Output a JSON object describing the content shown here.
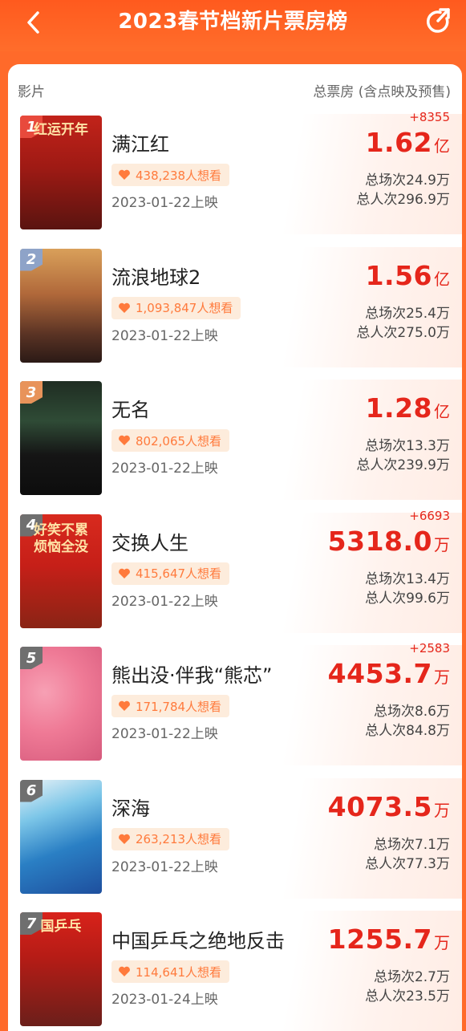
{
  "header": {
    "title": "2023春节档新片票房榜",
    "back_icon": "chevron-left-icon",
    "share_icon": "share-refresh-icon"
  },
  "columns": {
    "left": "影片",
    "right": "总票房 (含点映及预售)"
  },
  "colors": {
    "accent": "#ff6a2a",
    "price": "#e5261b",
    "want_text": "#ff7a3c",
    "want_bg": "#fdecdc"
  },
  "movies": [
    {
      "rank": "1",
      "title": "满江红",
      "want": "438,238人想看",
      "date": "2023-01-22上映",
      "delta": "+8355",
      "box_value": "1.62",
      "box_unit": "亿",
      "shows": "总场次24.9万",
      "viewers": "总人次296.9万",
      "poster_text": "红运开年",
      "rank_color": "#e84a3c"
    },
    {
      "rank": "2",
      "title": "流浪地球2",
      "want": "1,093,847人想看",
      "date": "2023-01-22上映",
      "delta": "",
      "box_value": "1.56",
      "box_unit": "亿",
      "shows": "总场次25.4万",
      "viewers": "总人次275.0万",
      "poster_text": "",
      "rank_color": "#8ea3c8"
    },
    {
      "rank": "3",
      "title": "无名",
      "want": "802,065人想看",
      "date": "2023-01-22上映",
      "delta": "",
      "box_value": "1.28",
      "box_unit": "亿",
      "shows": "总场次13.3万",
      "viewers": "总人次239.9万",
      "poster_text": "",
      "rank_color": "#e8935a"
    },
    {
      "rank": "4",
      "title": "交换人生",
      "want": "415,647人想看",
      "date": "2023-01-22上映",
      "delta": "+6693",
      "box_value": "5318.0",
      "box_unit": "万",
      "shows": "总场次13.4万",
      "viewers": "总人次99.6万",
      "poster_text": "好笑不累 烦恼全没",
      "rank_color": "#6f6f6f"
    },
    {
      "rank": "5",
      "title": "熊出没·伴我“熊芯”",
      "want": "171,784人想看",
      "date": "2023-01-22上映",
      "delta": "+2583",
      "box_value": "4453.7",
      "box_unit": "万",
      "shows": "总场次8.6万",
      "viewers": "总人次84.8万",
      "poster_text": "",
      "rank_color": "#6f6f6f"
    },
    {
      "rank": "6",
      "title": "深海",
      "want": "263,213人想看",
      "date": "2023-01-22上映",
      "delta": "",
      "box_value": "4073.5",
      "box_unit": "万",
      "shows": "总场次7.1万",
      "viewers": "总人次77.3万",
      "poster_text": "",
      "rank_color": "#6f6f6f"
    },
    {
      "rank": "7",
      "title": "中国乒乓之绝地反击",
      "want": "114,641人想看",
      "date": "2023-01-24上映",
      "delta": "",
      "box_value": "1255.7",
      "box_unit": "万",
      "shows": "总场次2.7万",
      "viewers": "总人次23.5万",
      "poster_text": "国乒乓",
      "rank_color": "#6f6f6f"
    }
  ]
}
